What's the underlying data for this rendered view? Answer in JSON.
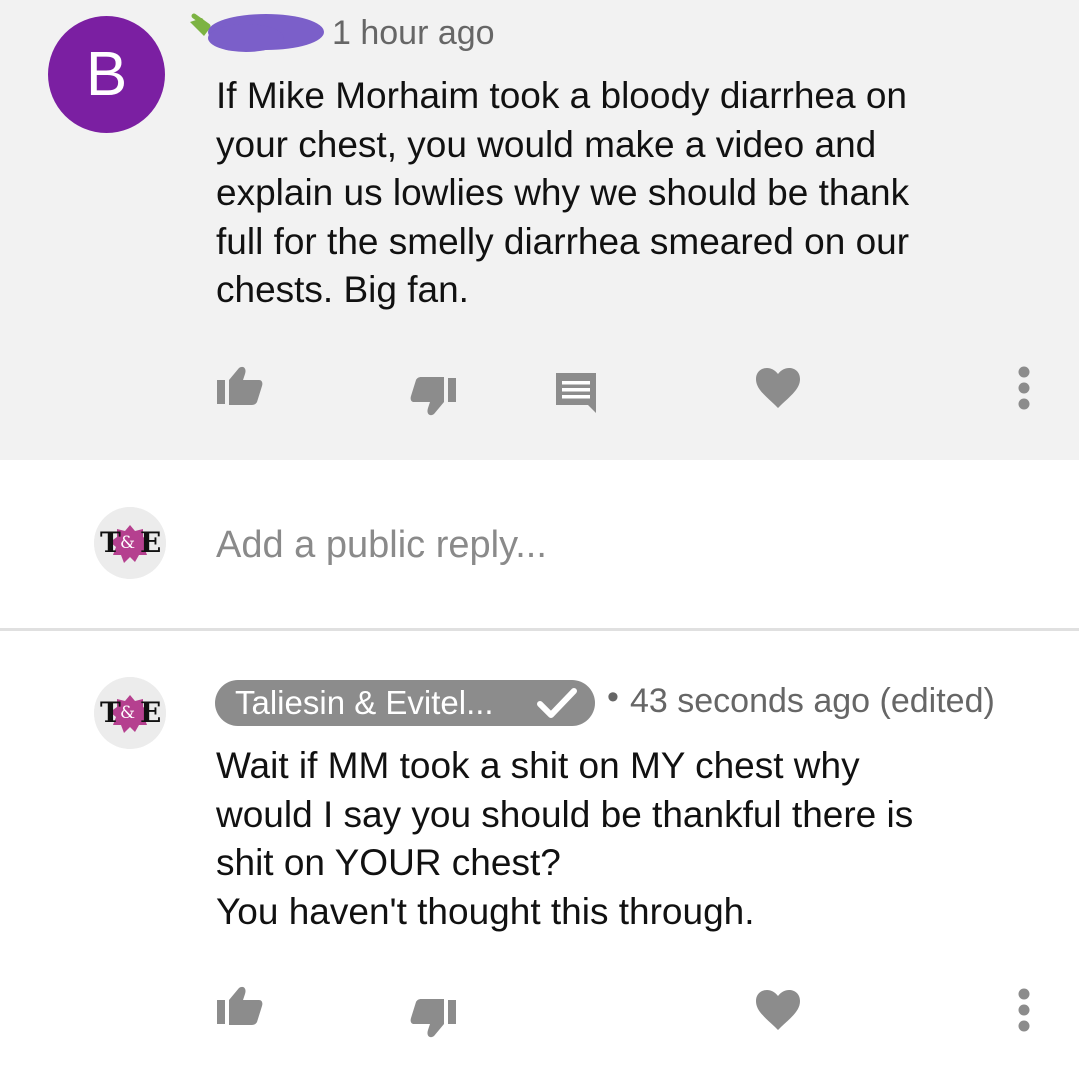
{
  "colors": {
    "highlight_background": "#f2f2f2",
    "avatar_purple": "#7b1fa2",
    "icon_grey": "#8c8c8c",
    "meta_grey": "#666666",
    "placeholder_grey": "#8a8a8a",
    "name_scribble": "#7b5fc9",
    "te_pink": "#b5408f"
  },
  "comment_1": {
    "avatar_letter": "B",
    "author_name_redacted": true,
    "timestamp": "1 hour ago",
    "text": "If Mike Morhaim took a bloody diarrhea on\nyour chest, you would make a video and\nexplain us lowlies why we should be thank\nfull for the smelly diarrhea smeared on our\nchests. Big fan.",
    "actions": [
      "thumbs-up-icon",
      "thumbs-down-icon",
      "reply-icon",
      "heart-icon",
      "more-vert-icon"
    ]
  },
  "reply_box": {
    "avatar_text": "T&E",
    "placeholder": "Add a public reply..."
  },
  "comment_2": {
    "avatar_text": "T&E",
    "channel_name": "Taliesin & Evitel...",
    "verified": true,
    "separator": "•",
    "timestamp": "43 seconds ago (edited)",
    "text": "Wait if MM took a shit on MY chest why\nwould I say you should be thankful there is\nshit on YOUR chest?\nYou haven't thought this through.",
    "actions": [
      "thumbs-up-icon",
      "thumbs-down-icon",
      "heart-icon",
      "more-vert-icon"
    ]
  }
}
